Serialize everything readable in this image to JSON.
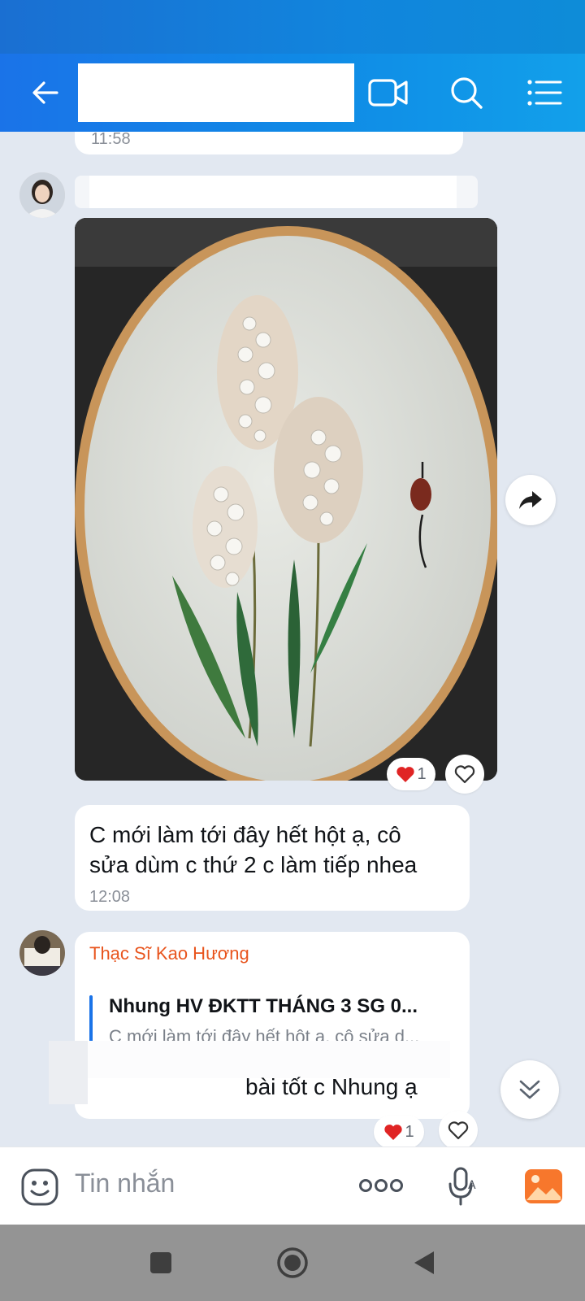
{
  "header": {
    "title": ""
  },
  "messages": [
    {
      "time": "11:58"
    },
    {
      "type": "photo",
      "reactions": {
        "count": "1"
      }
    },
    {
      "text_line1": "C mới làm tới đây hết hột ạ, cô",
      "text_line2": "sửa dùm c thứ 2 c làm tiếp nhea",
      "time": "12:08"
    },
    {
      "sender": "Thạc Sĩ Kao Hương",
      "quote_title": "Nhung HV ĐKTT THÁNG 3 SG 0...",
      "quote_body": "C mới làm tới đây hết hột ạ, cô sửa d...",
      "text": "bài tốt c Nhung ạ",
      "reactions": {
        "count": "1"
      }
    }
  ],
  "input": {
    "placeholder": "Tin nhắn"
  },
  "icons": {
    "back": "arrow-left-icon",
    "video": "video-call-icon",
    "search": "search-icon",
    "menu": "list-menu-icon",
    "forward": "share-forward-icon",
    "scroll_down": "double-chevron-down-icon",
    "emoji": "emoji-icon",
    "more": "more-dots-icon",
    "voice": "microphone-icon",
    "gallery": "image-gallery-icon"
  },
  "colors": {
    "header": "#1a73e8",
    "sender": "#e8541d",
    "quote_bar": "#1a73e8",
    "heart": "#e02424"
  }
}
